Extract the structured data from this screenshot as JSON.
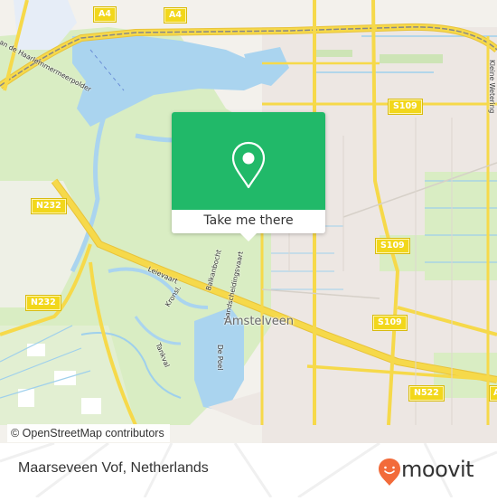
{
  "map": {
    "colors": {
      "land": "#f3f1ec",
      "green": "#d7ecc0",
      "water": "#aad4ef",
      "urban": "#ede6e2",
      "road": "#f6d94a",
      "road_casing": "#e8c33a",
      "rail": "#888888",
      "canal": "#9fd0ec"
    },
    "road_shields": [
      {
        "id": "a4-left",
        "label": "A4"
      },
      {
        "id": "a4-right",
        "label": "A4"
      },
      {
        "id": "s109-top",
        "label": "S109"
      },
      {
        "id": "n232-top",
        "label": "N232"
      },
      {
        "id": "n232-bottom",
        "label": "N232"
      },
      {
        "id": "s109-middle",
        "label": "S109"
      },
      {
        "id": "s109-lower",
        "label": "S109"
      },
      {
        "id": "n522",
        "label": "N522"
      },
      {
        "id": "a-edge",
        "label": "A"
      }
    ],
    "street_labels": [
      {
        "id": "hoofdweg",
        "label": "an de Haarlemmermeerpolder"
      },
      {
        "id": "kleine-wetering",
        "label": "Kleine Wetering"
      },
      {
        "id": "leievaart",
        "label": "Leievaart"
      },
      {
        "id": "kronsl",
        "label": "Kronsl."
      },
      {
        "id": "bakkenbocht",
        "label": "Balkanbocht"
      },
      {
        "id": "landscheidingsvaart",
        "label": "Landscheidingsvaart"
      },
      {
        "id": "tankval",
        "label": "Tankval"
      },
      {
        "id": "de-poel",
        "label": "De Poel"
      }
    ],
    "city_label": "Amstelveen"
  },
  "popup": {
    "icon": "map-pin-icon",
    "color": "#21b969",
    "cta_label": "Take me there"
  },
  "attribution": "© OpenStreetMap contributors",
  "footer": {
    "place_name": "Maarseveen Vof, Netherlands",
    "brand": {
      "name": "moovit",
      "color": "#f26b3a"
    }
  }
}
